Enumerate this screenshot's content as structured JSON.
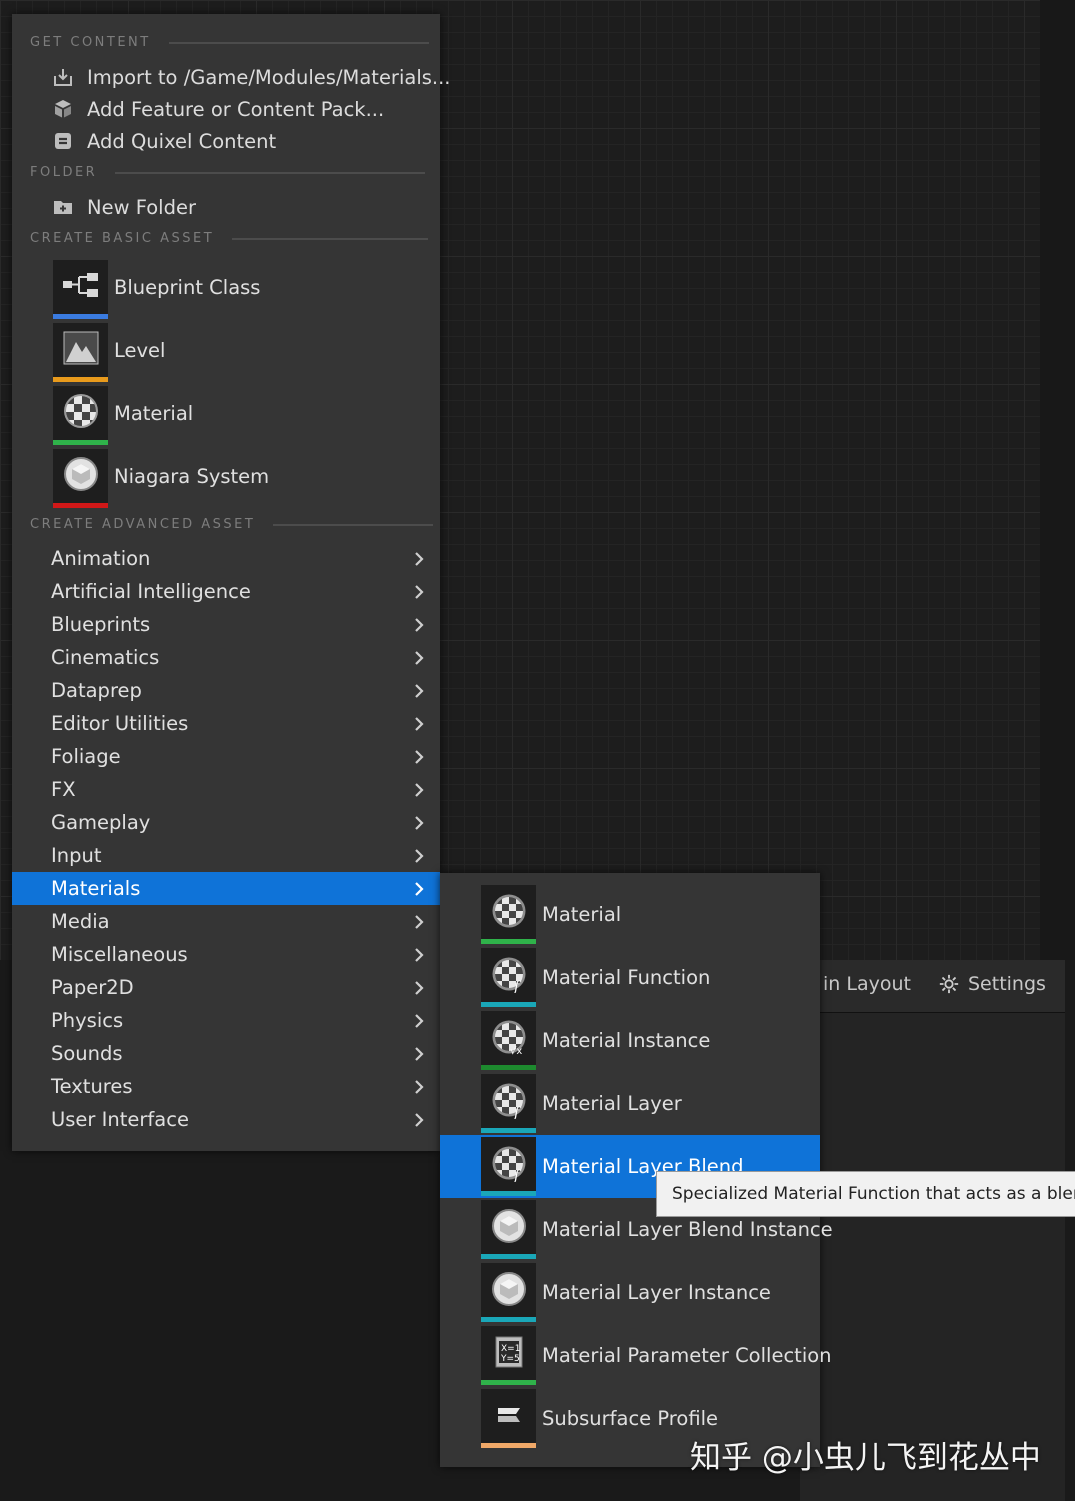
{
  "toolbar": {
    "layout_label": "in Layout",
    "settings_label": "Settings"
  },
  "menu": {
    "sections": {
      "get_content": "GET CONTENT",
      "folder": "FOLDER",
      "create_basic": "CREATE BASIC ASSET",
      "create_advanced": "CREATE ADVANCED ASSET"
    },
    "get_content_items": [
      {
        "label": "Import to /Game/Modules/Materials...",
        "icon": "import-icon"
      },
      {
        "label": "Add Feature or Content Pack...",
        "icon": "feature-pack-icon"
      },
      {
        "label": "Add Quixel Content",
        "icon": "quixel-icon"
      }
    ],
    "folder_items": [
      {
        "label": "New Folder",
        "icon": "new-folder-icon"
      }
    ],
    "basic_assets": [
      {
        "label": "Blueprint Class",
        "icon": "blueprint-icon",
        "color": "#3a7be0"
      },
      {
        "label": "Level",
        "icon": "level-icon",
        "color": "#e89a1c"
      },
      {
        "label": "Material",
        "icon": "material-icon",
        "color": "#2fb24a"
      },
      {
        "label": "Niagara System",
        "icon": "niagara-icon",
        "color": "#d11818"
      }
    ],
    "categories": [
      "Animation",
      "Artificial Intelligence",
      "Blueprints",
      "Cinematics",
      "Dataprep",
      "Editor Utilities",
      "Foliage",
      "FX",
      "Gameplay",
      "Input",
      "Materials",
      "Media",
      "Miscellaneous",
      "Paper2D",
      "Physics",
      "Sounds",
      "Textures",
      "User Interface"
    ],
    "active_category": "Materials"
  },
  "submenu": {
    "items": [
      {
        "label": "Material",
        "icon": "material-icon",
        "color": "#2fb24a"
      },
      {
        "label": "Material Function",
        "icon": "material-function-icon",
        "color": "#1aa7b8"
      },
      {
        "label": "Material Instance",
        "icon": "material-instance-icon",
        "color": "#1d8a2e"
      },
      {
        "label": "Material Layer",
        "icon": "material-layer-icon",
        "color": "#1aa7b8"
      },
      {
        "label": "Material Layer Blend",
        "icon": "material-layer-blend-icon",
        "color": "#1aa7b8"
      },
      {
        "label": "Material Layer Blend Instance",
        "icon": "material-layer-blend-instance-icon",
        "color": "#1aa7b8"
      },
      {
        "label": "Material Layer Instance",
        "icon": "material-layer-instance-icon",
        "color": "#1aa7b8"
      },
      {
        "label": "Material Parameter Collection",
        "icon": "material-parameter-collection-icon",
        "color": "#2fb24a"
      },
      {
        "label": "Subsurface Profile",
        "icon": "subsurface-profile-icon",
        "color": "#f0a868"
      }
    ],
    "active_item": "Material Layer Blend"
  },
  "tooltip": "Specialized Material Function that acts as a blend",
  "watermark": "知乎 @小虫儿飞到花丛中"
}
